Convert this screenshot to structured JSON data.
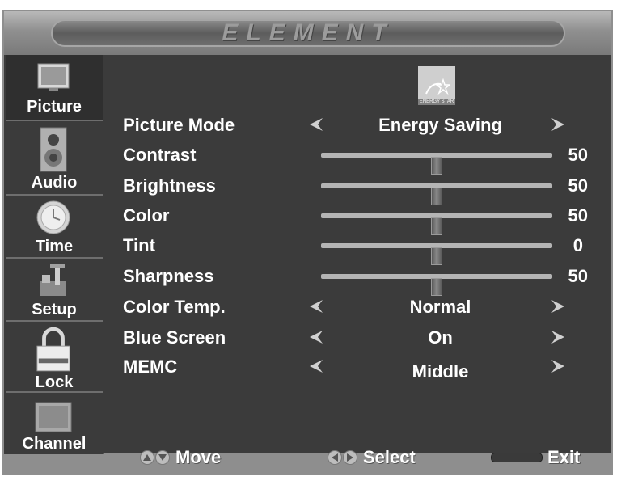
{
  "brand": "ELEMENT",
  "energy_badge": "ENERGY STAR",
  "sidebar": {
    "items": [
      {
        "label": "Picture",
        "icon": "picture-icon"
      },
      {
        "label": "Audio",
        "icon": "speaker-icon"
      },
      {
        "label": "Time",
        "icon": "clock-icon"
      },
      {
        "label": "Setup",
        "icon": "tools-icon"
      },
      {
        "label": "Lock",
        "icon": "lock-icon"
      },
      {
        "label": "Channel",
        "icon": "channel-icon"
      }
    ]
  },
  "menu": {
    "picture_mode": {
      "label": "Picture Mode",
      "value": "Energy Saving"
    },
    "contrast": {
      "label": "Contrast",
      "value": "50",
      "level": 50
    },
    "brightness": {
      "label": "Brightness",
      "value": "50",
      "level": 50
    },
    "color": {
      "label": "Color",
      "value": "50",
      "level": 50
    },
    "tint": {
      "label": "Tint",
      "value": "0",
      "level": 50
    },
    "sharpness": {
      "label": "Sharpness",
      "value": "50",
      "level": 50
    },
    "color_temp": {
      "label": "Color Temp.",
      "value": "Normal"
    },
    "blue_screen": {
      "label": "Blue Screen",
      "value": "On"
    },
    "memc": {
      "label": "MEMC",
      "value": "Middle"
    }
  },
  "footer": {
    "move": "Move",
    "select": "Select",
    "exit": "Exit"
  }
}
